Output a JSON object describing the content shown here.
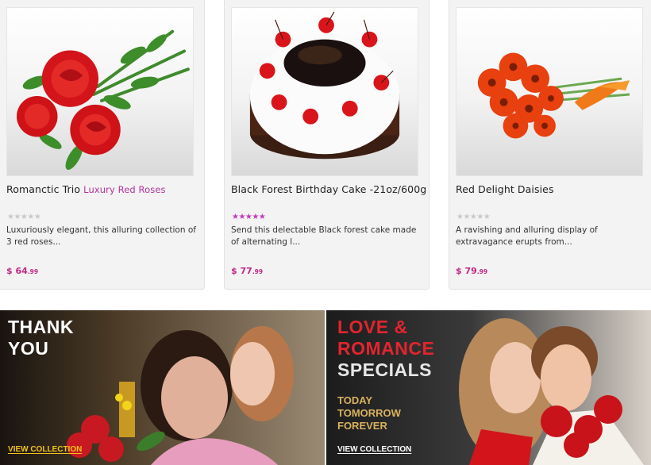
{
  "products": [
    {
      "title": "Romanctic Trio",
      "subtitle": "Luxury Red Roses",
      "rating": 0,
      "image_icon": "red-roses-bouquet",
      "description": "Luxuriously elegant, this alluring collection of 3 red roses...",
      "price_currency": "$",
      "price_whole": "64",
      "price_cents": ".99"
    },
    {
      "title": "Black Forest Birthday Cake -21oz/600g",
      "subtitle": "",
      "rating": 5,
      "image_icon": "black-forest-cake",
      "description": "Send this delectable Black forest cake made of alternating l...",
      "price_currency": "$",
      "price_whole": "77",
      "price_cents": ".99"
    },
    {
      "title": "Red Delight Daisies",
      "subtitle": "",
      "rating": 0,
      "image_icon": "red-gerbera-daisies",
      "description": "A ravishing and alluring display of extravagance erupts from...",
      "price_currency": "$",
      "price_whole": "79",
      "price_cents": ".99"
    }
  ],
  "stars_glyphs": "★★★★★",
  "banners": {
    "thank_you": {
      "headline": "THANK YOU",
      "cta": "VIEW COLLECTION"
    },
    "love": {
      "headline_red": "LOVE & ROMANCE",
      "headline_white": "SPECIALS",
      "sub": "TODAY TOMORROW FOREVER",
      "cta": "VIEW COLLECTION"
    }
  },
  "colors": {
    "accent_pink": "#b3339b",
    "price": "#c02a86",
    "banner_yellow": "#f0c419",
    "banner_red": "#e1252e"
  }
}
